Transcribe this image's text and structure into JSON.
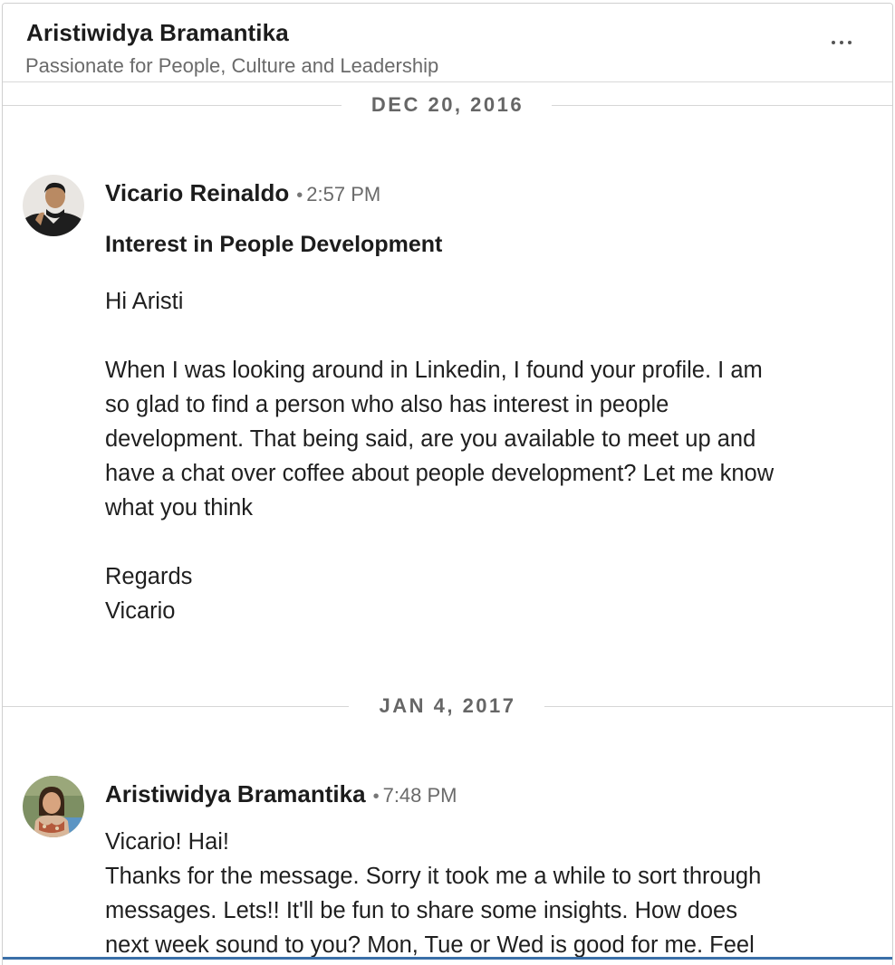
{
  "header": {
    "name": "Aristiwidya Bramantika",
    "headline": "Passionate for People, Culture and Leadership",
    "more_icon": "more-horizontal-icon"
  },
  "conversation": {
    "dividers": [
      {
        "label": "DEC 20, 2016"
      },
      {
        "label": "JAN 4, 2017"
      }
    ],
    "messages": [
      {
        "sender": "Vicario Reinaldo",
        "separator": "•",
        "time": "2:57 PM",
        "subject": "Interest in People Development",
        "lines": [
          "Hi Aristi",
          "",
          "When I was looking around in Linkedin, I found your profile. I am",
          "so glad to find a person who also has interest in people",
          "development. That being said, are you available to meet up and",
          "have a chat over coffee about people development? Let me know",
          "what you think",
          "",
          "Regards",
          "Vicario"
        ]
      },
      {
        "sender": "Aristiwidya Bramantika",
        "separator": "•",
        "time": "7:48 PM",
        "lines": [
          "Vicario! Hai!",
          "Thanks for the message. Sorry it took me a while to sort through",
          "messages. Lets!! It'll be fun to share some insights. How does",
          "next week sound to you? Mon, Tue or Wed is good for me. Feel"
        ]
      }
    ]
  },
  "colors": {
    "accent_bar": "#3a6fa8",
    "divider": "#d6d6d6"
  }
}
